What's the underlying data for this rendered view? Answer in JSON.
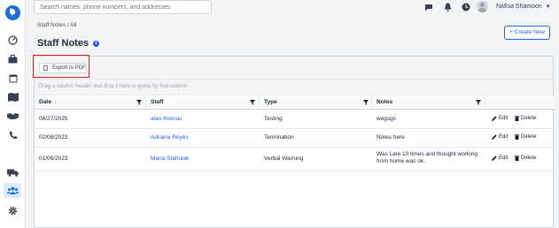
{
  "search": {
    "placeholder": "Search names, phone numbers, and addresses"
  },
  "user": {
    "name": "Nafisa Shamoon",
    "dropdown_icon": "caret-down-icon"
  },
  "sidebar": {
    "icons": [
      "dashboard-icon",
      "briefcase-icon",
      "calendar-icon",
      "map-icon",
      "handshake-icon",
      "phone-icon",
      "truck-icon",
      "users-icon",
      "gear-icon"
    ],
    "active": "users-icon"
  },
  "header_icons": [
    "chat-icon",
    "bell-icon",
    "clock-icon"
  ],
  "breadcrumb": "Staff Notes / All",
  "page": {
    "title": "Staff Notes",
    "create_label": "+ Create New"
  },
  "grid": {
    "export_label": "Export to PDF",
    "group_hint": "Drag a column header and drop it here to group by that column",
    "columns": [
      "Date",
      "Staff",
      "Type",
      "Notes"
    ],
    "sort_indicator": "↓",
    "rows": [
      {
        "date": "08/27/2025",
        "staff": "alan thomas",
        "type": "Testing",
        "notes": "wegsgs"
      },
      {
        "date": "02/08/2023",
        "staff": "Adriana Reyes",
        "type": "Termination",
        "notes": "Notes here"
      },
      {
        "date": "01/06/2023",
        "staff": "Maria Stahulak",
        "type": "Verbal Warning",
        "notes": "Was Late 10 times and thought working from home was ok."
      }
    ],
    "edit_label": "Edit",
    "delete_label": "Delete"
  },
  "colors": {
    "accent": "#2563eb",
    "highlight": "#e11d1d",
    "brand": "#1e6fd0"
  }
}
